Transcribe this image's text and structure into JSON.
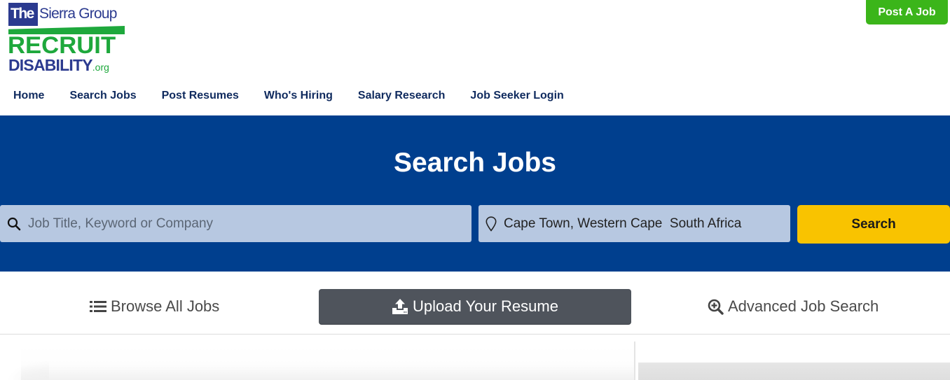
{
  "brand": {
    "logo_the": "The",
    "logo_sierra": "Sierra Group",
    "logo_recruit": "RECRUIT",
    "logo_disability": "DISABILITY",
    "logo_org": ".org",
    "colors": {
      "navy": "#2b3a8f",
      "green": "#1ea83c"
    }
  },
  "header": {
    "post_job_label": "Post A Job"
  },
  "nav": {
    "items": [
      {
        "label": "Home"
      },
      {
        "label": "Search Jobs"
      },
      {
        "label": "Post Resumes"
      },
      {
        "label": "Who's Hiring"
      },
      {
        "label": "Salary Research"
      },
      {
        "label": "Job Seeker Login"
      }
    ]
  },
  "search": {
    "title": "Search Jobs",
    "keyword": {
      "icon": "search-icon",
      "placeholder": "Job Title, Keyword or Company",
      "value": ""
    },
    "location": {
      "icon": "map-pin-icon",
      "placeholder": "",
      "value": "Cape Town, Western Cape  South Africa"
    },
    "button_label": "Search",
    "colors": {
      "band": "#003f8e",
      "field": "#b7c8e1",
      "button": "#f9c300"
    }
  },
  "actions": {
    "browse": {
      "icon": "list-icon",
      "label": "Browse All Jobs"
    },
    "upload": {
      "icon": "upload-icon",
      "label": "Upload Your Resume"
    },
    "advanced": {
      "icon": "zoom-in-icon",
      "label": "Advanced Job Search"
    }
  }
}
